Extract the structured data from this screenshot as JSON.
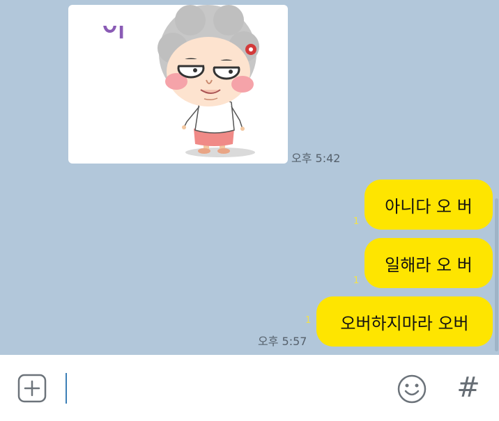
{
  "messages": {
    "incoming_sticker": {
      "time": "오후 5:42",
      "sticker_text": "아"
    },
    "outgoing": [
      {
        "text": "아니다 오 버",
        "unread": "1"
      },
      {
        "text": "일해라 오 버",
        "unread": "1"
      },
      {
        "text": "오버하지마라 오버",
        "unread": "1",
        "time": "오후 5:57"
      }
    ]
  },
  "input_bar": {
    "placeholder": "",
    "plus_icon": "plus-square-icon",
    "emoji_icon": "smiley-icon",
    "hash_label": "#"
  },
  "colors": {
    "chat_background": "#b2c7da",
    "bubble_yellow": "#fee500",
    "unread_yellow": "#f2e24a"
  }
}
